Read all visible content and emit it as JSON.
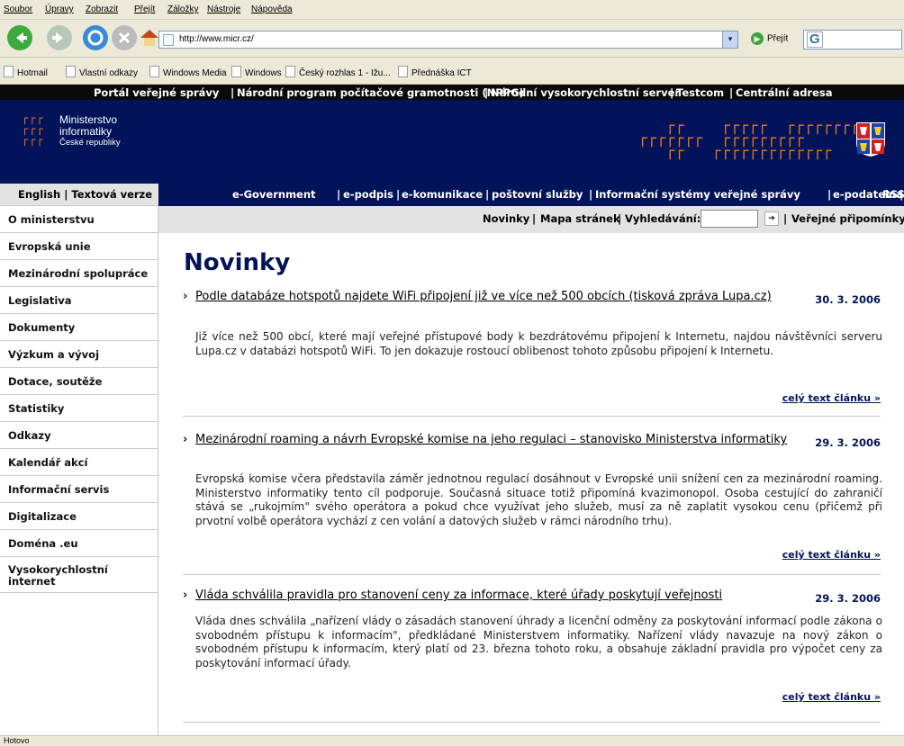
{
  "browser": {
    "menu": [
      "Soubor",
      "Úpravy",
      "Zobrazit",
      "Přejít",
      "Záložky",
      "Nástroje",
      "Nápověda"
    ],
    "address": "http://www.micr.cz/",
    "go_label": "Přejít",
    "links": [
      "Hotmail",
      "Vlastní odkazy",
      "Windows Media",
      "Windows",
      "Český rozhlas 1 - Ižu...",
      "Přednáška ICT"
    ],
    "status": "Hotovo"
  },
  "portal_links": [
    "Portál veřejné správy",
    "Národní program počítačové gramotnosti (NPPG)",
    "Národní vysokorychlostní server",
    "Testcom",
    "Centrální adresa"
  ],
  "logo": {
    "line1": "Ministerstvo",
    "line2": "informatiky",
    "line3": "České republiky"
  },
  "lang": "English | Textová verze",
  "topnav": [
    "e-Government",
    "e-podpis",
    "e-komunikace",
    "poštovní služby",
    "Informační systémy veřejné správy",
    "e-podatelna",
    "RSS"
  ],
  "sidebar": [
    {
      "label": "O ministerstvu"
    },
    {
      "label": "Evropská unie"
    },
    {
      "label": "Mezinárodní spolupráce"
    },
    {
      "label": "Legislativa"
    },
    {
      "label": "Dokumenty"
    },
    {
      "label": "Výzkum a vývoj"
    },
    {
      "label": "Dotace, soutěže"
    },
    {
      "label": "Statistiky"
    },
    {
      "label": "Odkazy"
    },
    {
      "label": "Kalendář akcí"
    },
    {
      "label": "Informační servis"
    },
    {
      "label": "Digitalizace"
    },
    {
      "label": "Doména .eu"
    },
    {
      "label": "Vysokorychlostní internet"
    }
  ],
  "crumbs": {
    "news": "Novinky",
    "sitemap": "Mapa stránek",
    "search": "Vyhledávání:",
    "comments": "Veřejné připomínky"
  },
  "page_title": "Novinky",
  "more_label": "celý text článku »",
  "articles": [
    {
      "title": "Podle databáze hotspotů najdete WiFi připojení již ve více než 500 obcích (tisková zpráva Lupa.cz)",
      "date": "30. 3. 2006",
      "body": "Již více než 500 obcí, které mají veřejné přístupové body k bezdrátovému připojení k Internetu, najdou návštěvníci serveru Lupa.cz v databázi hotspotů WiFi. To jen dokazuje rostoucí oblibenost tohoto způsobu připojení k Internetu."
    },
    {
      "title": "Mezinárodní roaming a návrh Evropské komise na jeho regulaci – stanovisko Ministerstva informatiky",
      "date": "29. 3. 2006",
      "body": "Evropská komise včera představila záměr jednotnou regulací dosáhnout v Evropské unii snížení cen za mezinárodní roaming. Ministerstvo informatiky tento cíl podporuje. Současná situace totiž připomíná kvazimonopol. Osoba cestující do zahraničí stává se „rukojmím\" svého operátora a pokud chce využívat jeho služeb, musí za ně zaplatit vysokou cenu (přičemž při prvotní volbě operátora vychází z cen volání a datových služeb v rámci národního trhu)."
    },
    {
      "title": "Vláda schválila pravidla pro stanovení ceny za informace, které úřady poskytují veřejnosti",
      "date": "29. 3. 2006",
      "body": "Vláda dnes schválila „nařízení vlády o zásadách stanovení úhrady a licenční odměny za poskytování informací podle zákona o svobodném přístupu k informacím\", předkládané Ministerstvem informatiky. Nařízení vlády navazuje na nový zákon o svobodném přístupu k informacím, který platí od 23. března tohoto roku, a obsahuje základní pravidla pro výpočet ceny za poskytování informací úřady."
    }
  ]
}
